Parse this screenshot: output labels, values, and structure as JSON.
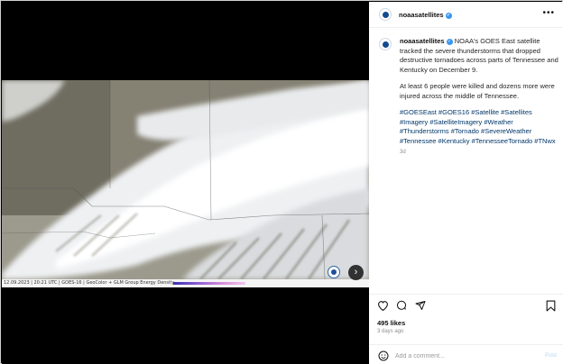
{
  "post": {
    "username": "noaasatellites",
    "caption_paragraph1": "NOAA's GOES East satellite tracked the severe thunderstorms that dropped destructive tornadoes across parts of Tennessee and Kentucky on December 9.",
    "caption_paragraph2": "At least 6 people were killed and dozens more were injured across the middle of Tennessee.",
    "hashtags": "#GOESEast #GOES16 #Satellite #Satellites #Imagery #SatelliteImagery #Weather #Thunderstorms #Tornado #SevereWeather #Tennessee #Kentucky #TennesseeTornado #TNwx",
    "caption_age": "3d",
    "likes": "495 likes",
    "posted_ago": "3 days ago"
  },
  "media": {
    "image_caption": "12.09.2023 | 20:21 UTC | GOES-16 | GeoColor + GLM Group Energy Density"
  },
  "comment": {
    "placeholder": "Add a comment...",
    "post_label": "Post"
  },
  "icons": {
    "more": "more-options-icon",
    "like": "heart-icon",
    "comment": "comment-icon",
    "share": "share-icon",
    "save": "bookmark-icon",
    "emoji": "emoji-icon",
    "next": "chevron-right-icon"
  },
  "colors": {
    "link": "#00376b",
    "verified": "#3897f0",
    "post_button": "#b5d7f7"
  }
}
